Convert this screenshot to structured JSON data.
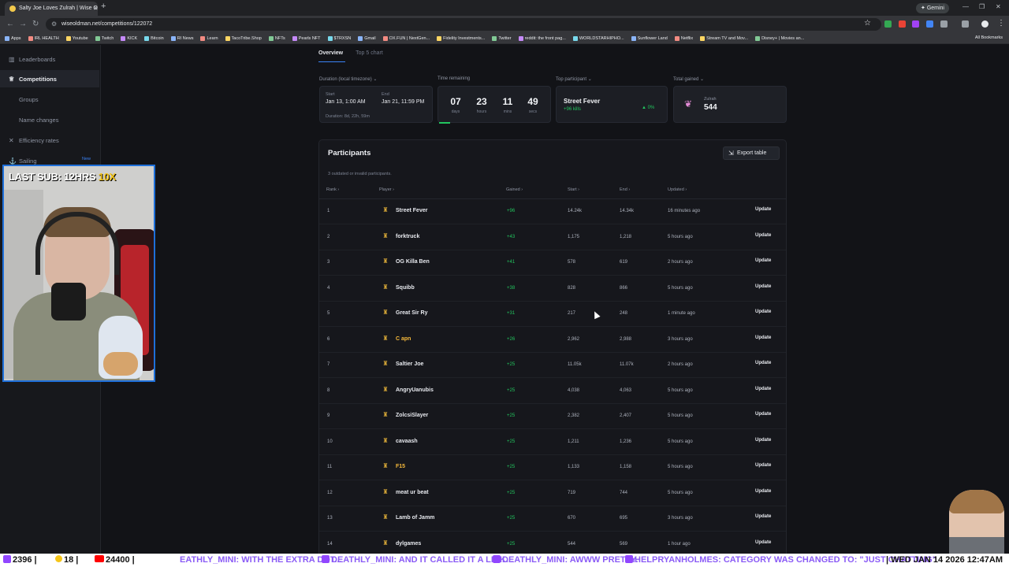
{
  "browser": {
    "tab_title": "Salty Joe Loves Zulrah | Wise O",
    "gemini_label": "Gemini",
    "url": "wiseoldman.net/competitions/122072",
    "bookmarks": [
      "Apps",
      "IRL HEALTH",
      "Youtube",
      "Twitch",
      "KICK",
      "Bitcoin",
      "RI News",
      "Learn",
      "TacoTribe.Shop",
      "NFTs",
      "Pearls NFT",
      "$TRXSN",
      "Gmail",
      "OX.FUN | NextGen...",
      "Fidelity Investments...",
      "Twitter",
      "reddit: the front pag...",
      "WORLDSTARHIPHO...",
      "Sunflower Land",
      "Netflix",
      "Stream TV and Mov...",
      "Disney+ | Movies an..."
    ],
    "all_bookmarks": "All Bookmarks"
  },
  "sidebar": {
    "items": [
      {
        "label": "Leaderboards",
        "icon": "leaderboard-icon"
      },
      {
        "label": "Competitions",
        "icon": "trophy-icon"
      },
      {
        "label": "Groups",
        "icon": "groups-icon"
      },
      {
        "label": "Name changes",
        "icon": "name-change-icon"
      },
      {
        "label": "Efficiency rates",
        "icon": "efficiency-icon"
      },
      {
        "label": "Sailing",
        "icon": "sailing-icon"
      }
    ],
    "new_badge": "New"
  },
  "overlay": {
    "last_sub_text": "LAST SUB: 12HRS",
    "last_sub_mult": "10X"
  },
  "competition": {
    "tabs": [
      "Overview",
      "Top 5 chart"
    ],
    "duration_label": "Duration (local timezone)",
    "start_label": "Start",
    "start_value": "Jan 13, 1:00 AM",
    "end_label": "End",
    "end_value": "Jan 21, 11:59 PM",
    "duration_value": "Duration: 8d, 22h, 59m",
    "time_remaining_label": "Time remaining",
    "timer": [
      {
        "value": "07",
        "unit": "days"
      },
      {
        "value": "23",
        "unit": "hours"
      },
      {
        "value": "11",
        "unit": "mins"
      },
      {
        "value": "49",
        "unit": "secs"
      }
    ],
    "top_participant_label": "Top participant",
    "top_participant_name": "Street Fever",
    "top_participant_gain": "+96 kills",
    "top_participant_pct": "0%",
    "total_gained_label": "Total gained",
    "total_gained_metric": "Zulrah",
    "total_gained_value": "544"
  },
  "participants": {
    "title": "Participants",
    "export_label": "Export table",
    "outdated_note": "3 outdated or invalid participants.",
    "columns": [
      "Rank",
      "Player",
      "Gained",
      "Start",
      "End",
      "Updated"
    ],
    "update_label": "Update",
    "rows": [
      {
        "rank": "1",
        "player": "Street Fever",
        "gained": "+96",
        "start": "14.24k",
        "end": "14.34k",
        "updated": "16 minutes ago",
        "gold": false
      },
      {
        "rank": "2",
        "player": "forktruck",
        "gained": "+43",
        "start": "1,175",
        "end": "1,218",
        "updated": "5 hours ago",
        "gold": false
      },
      {
        "rank": "3",
        "player": "OG Killa Ben",
        "gained": "+41",
        "start": "578",
        "end": "619",
        "updated": "2 hours ago",
        "gold": false
      },
      {
        "rank": "4",
        "player": "Squibb",
        "gained": "+38",
        "start": "828",
        "end": "866",
        "updated": "5 hours ago",
        "gold": false
      },
      {
        "rank": "5",
        "player": "Great Sir Ry",
        "gained": "+31",
        "start": "217",
        "end": "248",
        "updated": "1 minute ago",
        "gold": false
      },
      {
        "rank": "6",
        "player": "C apn",
        "gained": "+26",
        "start": "2,962",
        "end": "2,988",
        "updated": "3 hours ago",
        "gold": true
      },
      {
        "rank": "7",
        "player": "Saltier Joe",
        "gained": "+25",
        "start": "11.05k",
        "end": "11.07k",
        "updated": "2 hours ago",
        "gold": false
      },
      {
        "rank": "8",
        "player": "AngryUanubis",
        "gained": "+25",
        "start": "4,038",
        "end": "4,063",
        "updated": "5 hours ago",
        "gold": false
      },
      {
        "rank": "9",
        "player": "ZolcsiSlayer",
        "gained": "+25",
        "start": "2,382",
        "end": "2,407",
        "updated": "5 hours ago",
        "gold": false
      },
      {
        "rank": "10",
        "player": "cavaash",
        "gained": "+25",
        "start": "1,211",
        "end": "1,236",
        "updated": "5 hours ago",
        "gold": false
      },
      {
        "rank": "11",
        "player": "F15",
        "gained": "+25",
        "start": "1,133",
        "end": "1,158",
        "updated": "5 hours ago",
        "gold": true
      },
      {
        "rank": "12",
        "player": "meat ur beat",
        "gained": "+25",
        "start": "719",
        "end": "744",
        "updated": "5 hours ago",
        "gold": false
      },
      {
        "rank": "13",
        "player": "Lamb of Jamm",
        "gained": "+25",
        "start": "670",
        "end": "695",
        "updated": "3 hours ago",
        "gold": false
      },
      {
        "rank": "14",
        "player": "dylgames",
        "gained": "+25",
        "start": "544",
        "end": "569",
        "updated": "1 hour ago",
        "gold": false
      }
    ]
  },
  "ticker": {
    "twitch_count": "2396",
    "kick_count": "18",
    "youtube_count": "24400",
    "messages": [
      "EATHLY_MINI: WITH THE EXTRA DOT...",
      "DEATHLY_MINI: AND IT CALLED IT A LINK...",
      "DEATHLY_MINI: AWWW PRETTY.",
      "HELPRYANHOLMES: CATEGORY WAS CHANGED TO: \"JUST CHATTING\""
    ],
    "datetime": "WED JAN 14 2026 12:47AM"
  }
}
